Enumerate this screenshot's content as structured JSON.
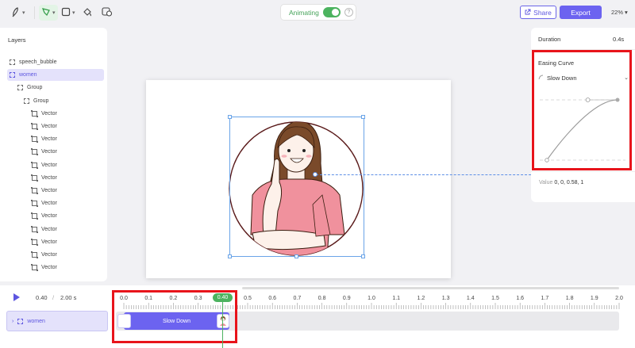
{
  "toolbar": {
    "tools": [
      {
        "icon": "pen-icon",
        "has_menu": true
      },
      {
        "icon": "shape-select-icon",
        "has_menu": true,
        "active": true
      },
      {
        "icon": "rectangle-icon",
        "has_menu": true
      },
      {
        "icon": "fill-bucket-icon",
        "has_menu": false
      },
      {
        "icon": "color-palette-icon",
        "has_menu": false
      }
    ],
    "animating_label": "Animating",
    "animating_on": true,
    "share_label": "Share",
    "export_label": "Export",
    "zoom": "22%"
  },
  "layers": {
    "title": "Layers",
    "items": [
      {
        "label": "speech_bubble",
        "type": "group",
        "depth": 0
      },
      {
        "label": "women",
        "type": "group",
        "depth": 0,
        "selected": true
      },
      {
        "label": "Group",
        "type": "group",
        "depth": 1
      },
      {
        "label": "Group",
        "type": "group",
        "depth": 2
      },
      {
        "label": "Vector",
        "type": "vector",
        "depth": 3
      },
      {
        "label": "Vector",
        "type": "vector",
        "depth": 3
      },
      {
        "label": "Vector",
        "type": "vector",
        "depth": 3
      },
      {
        "label": "Vector",
        "type": "vector",
        "depth": 3
      },
      {
        "label": "Vector",
        "type": "vector",
        "depth": 3
      },
      {
        "label": "Vector",
        "type": "vector",
        "depth": 3
      },
      {
        "label": "Vector",
        "type": "vector",
        "depth": 3
      },
      {
        "label": "Vector",
        "type": "vector",
        "depth": 3
      },
      {
        "label": "Vector",
        "type": "vector",
        "depth": 3
      },
      {
        "label": "Vector",
        "type": "vector",
        "depth": 3
      },
      {
        "label": "Vector",
        "type": "vector",
        "depth": 3
      },
      {
        "label": "Vector",
        "type": "vector",
        "depth": 3
      },
      {
        "label": "Vector",
        "type": "vector",
        "depth": 3
      }
    ]
  },
  "properties": {
    "duration_label": "Duration",
    "duration_value": "0.4s",
    "easing_label": "Easing Curve",
    "easing_selected": "Slow Down",
    "value_label": "Value",
    "value": "0, 0, 0.58, 1",
    "curve": [
      0,
      0,
      0.58,
      1
    ]
  },
  "timeline": {
    "current_time": "0.40",
    "separator": "/",
    "total_time": "2.00 s",
    "row_label": "women",
    "clip_label": "Slow Down",
    "playhead": "0.40",
    "ticks": [
      "0.0",
      "0.1",
      "0.2",
      "0.3",
      "0.4",
      "0.5",
      "0.6",
      "0.7",
      "0.8",
      "0.9",
      "1.0",
      "1.1",
      "1.2",
      "1.3",
      "1.4",
      "1.5",
      "1.6",
      "1.7",
      "1.8",
      "1.9",
      "2.0"
    ]
  },
  "colors": {
    "accent": "#6c63f0",
    "active_green": "#4cb35f",
    "highlight_red": "#e8141b",
    "shirt": "#f0919d",
    "hair": "#7a4a2a"
  }
}
